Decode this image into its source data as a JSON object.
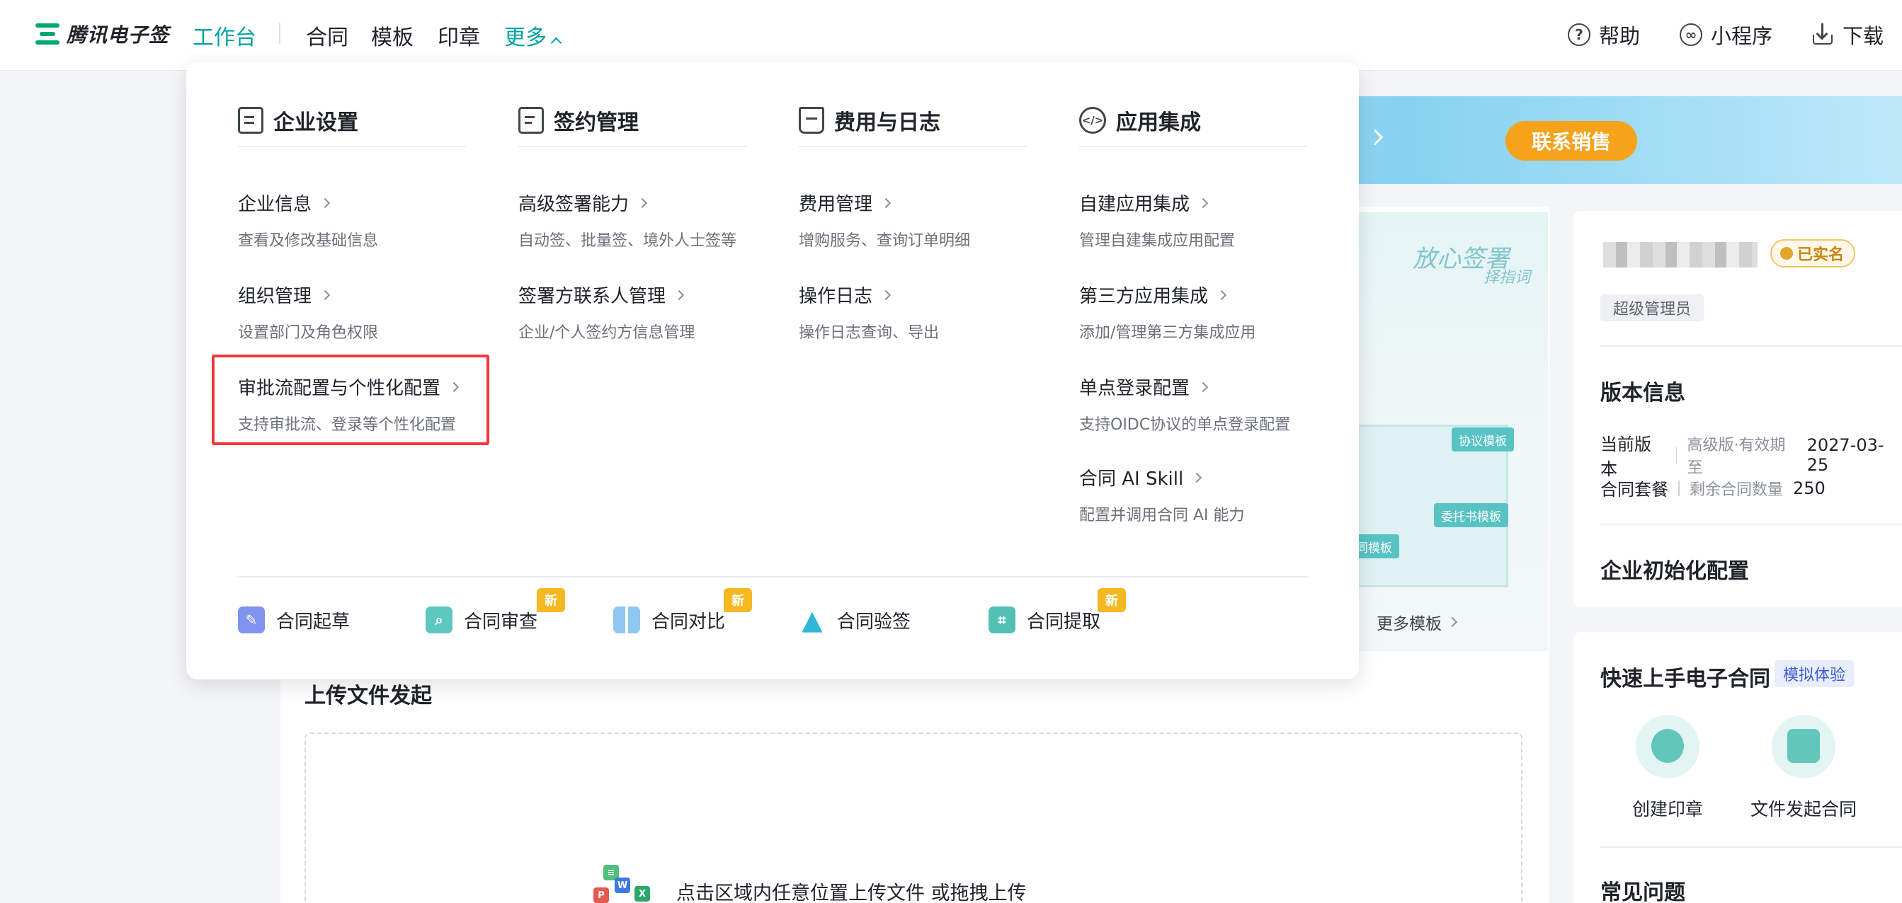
{
  "brand": {
    "name": "腾讯电子签",
    "accent": "#00a3a3"
  },
  "nav": {
    "items": [
      {
        "label": "工作台",
        "active": true
      },
      {
        "label": "合同"
      },
      {
        "label": "模板"
      },
      {
        "label": "印章"
      },
      {
        "label": "更多"
      }
    ],
    "right": [
      {
        "label": "帮助",
        "icon": "help-icon"
      },
      {
        "label": "小程序",
        "icon": "miniprogram-icon"
      },
      {
        "label": "下载",
        "icon": "download-icon"
      }
    ]
  },
  "banner": {
    "button": "联系销售"
  },
  "dropdown": {
    "columns": [
      {
        "title": "企业设置",
        "icon": "company-settings-icon",
        "items": [
          {
            "title": "企业信息",
            "desc": "查看及修改基础信息"
          },
          {
            "title": "组织管理",
            "desc": "设置部门及角色权限"
          },
          {
            "title": "审批流配置与个性化配置",
            "desc": "支持审批流、登录等个性化配置",
            "highlighted": true
          }
        ]
      },
      {
        "title": "签约管理",
        "icon": "signing-management-icon",
        "items": [
          {
            "title": "高级签署能力",
            "desc": "自动签、批量签、境外人士签等"
          },
          {
            "title": "签署方联系人管理",
            "desc": "企业/个人签约方信息管理"
          }
        ]
      },
      {
        "title": "费用与日志",
        "icon": "cost-log-icon",
        "items": [
          {
            "title": "费用管理",
            "desc": "增购服务、查询订单明细"
          },
          {
            "title": "操作日志",
            "desc": "操作日志查询、导出"
          }
        ]
      },
      {
        "title": "应用集成",
        "icon": "app-integration-icon",
        "items": [
          {
            "title": "自建应用集成",
            "desc": "管理自建集成应用配置"
          },
          {
            "title": "第三方应用集成",
            "desc": "添加/管理第三方集成应用"
          },
          {
            "title": "单点登录配置",
            "desc": "支持OIDC协议的单点登录配置"
          },
          {
            "title": "合同 AI Skill",
            "desc": "配置并调用合同 AI 能力"
          }
        ]
      }
    ],
    "tools": [
      {
        "label": "合同起草",
        "icon": "draft-pen-icon",
        "color": "#7f93ef",
        "badge": ""
      },
      {
        "label": "合同审查",
        "icon": "review-search-icon",
        "color": "#5ec7c0",
        "badge": "新"
      },
      {
        "label": "合同对比",
        "icon": "compare-icon",
        "color": "#8fc8f2",
        "badge": "新"
      },
      {
        "label": "合同验签",
        "icon": "verify-warning-icon",
        "color": "#30b7d8",
        "badge": ""
      },
      {
        "label": "合同提取",
        "icon": "extract-scan-icon",
        "color": "#52c0b2",
        "badge": "新"
      }
    ]
  },
  "templates": {
    "tags": [
      "协议模板",
      "委托书模板",
      "同模板"
    ],
    "script_main": "放心签署",
    "script_sub": "择指词",
    "more": "更多模板"
  },
  "upload": {
    "title": "上传文件发起",
    "hint": "点击区域内任意位置上传文件 或拖拽上传"
  },
  "side": {
    "verified": "已实名",
    "role": "超级管理员",
    "version_title": "版本信息",
    "current_version_label": "当前版本",
    "current_version_value": "高级版·有效期至",
    "expiry": "2027-03-25",
    "package_label": "合同套餐",
    "package_value": "剩余合同数量",
    "package_count": "250",
    "init_title": "企业初始化配置",
    "quick_title": "快速上手电子合同",
    "quick_tag": "模拟体验",
    "quick_items": [
      {
        "label": "创建印章",
        "icon": "seal-icon"
      },
      {
        "label": "文件发起合同",
        "icon": "file-contract-icon"
      }
    ],
    "faq_title": "常见问题"
  }
}
